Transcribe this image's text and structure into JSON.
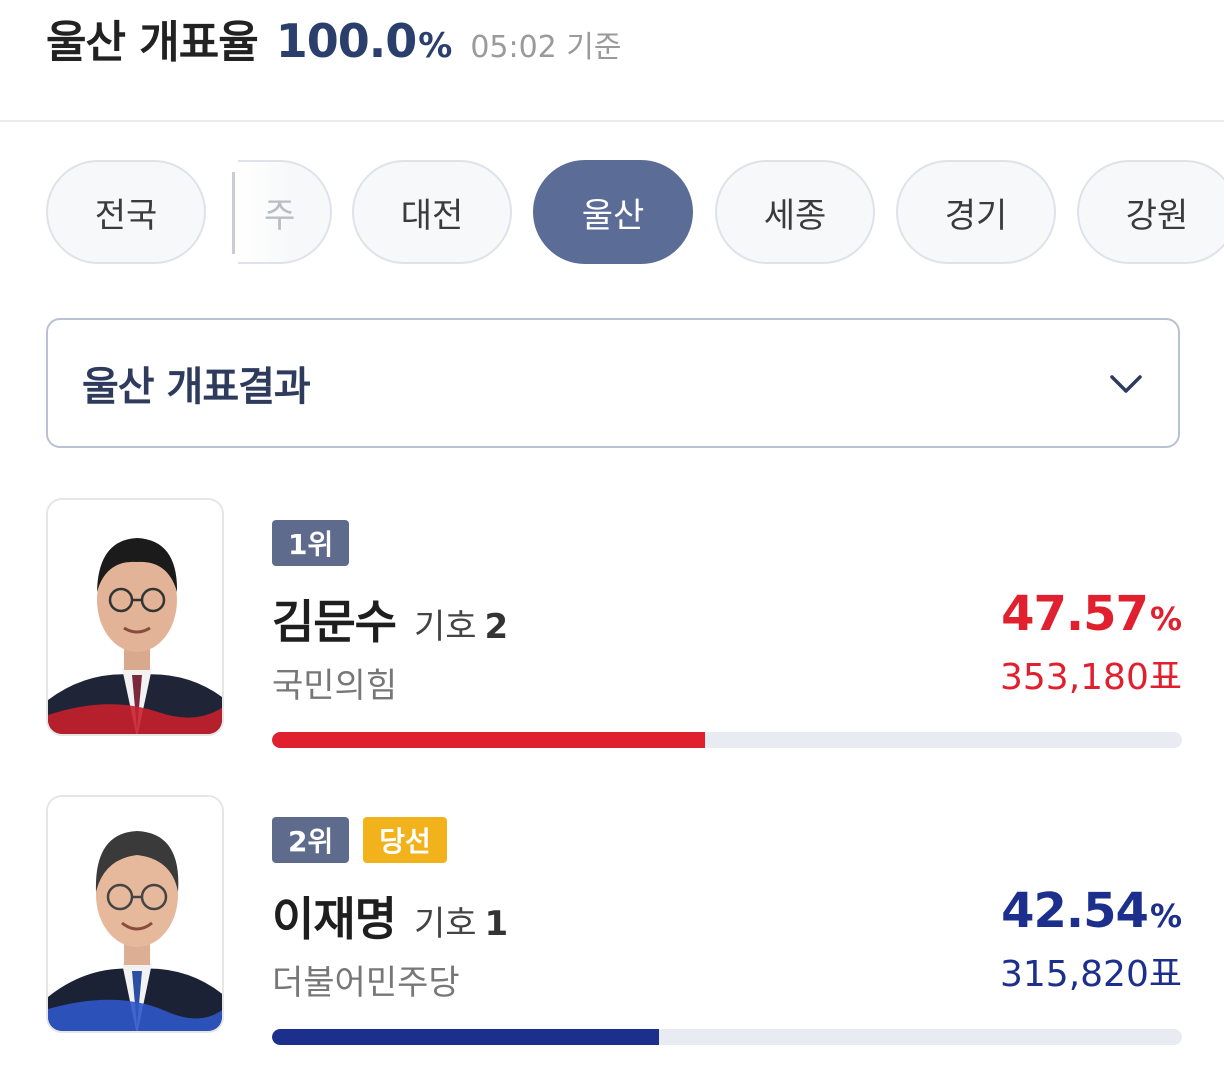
{
  "header": {
    "title": "울산 개표율",
    "rate_value": "100.0",
    "rate_unit": "%",
    "timestamp": "05:02 기준"
  },
  "tabs": [
    {
      "label": "전국",
      "active": false
    },
    {
      "label": "주",
      "active": false,
      "partial": true
    },
    {
      "label": "대전",
      "active": false
    },
    {
      "label": "울산",
      "active": true
    },
    {
      "label": "세종",
      "active": false
    },
    {
      "label": "경기",
      "active": false
    },
    {
      "label": "강원",
      "active": false
    }
  ],
  "dropdown": {
    "label": "울산 개표결과",
    "icon": "chevron-down-icon"
  },
  "candidates": [
    {
      "rank": "1위",
      "name": "김문수",
      "number_label": "기호",
      "number": "2",
      "party": "국민의힘",
      "percent": "47.57",
      "percent_unit": "%",
      "votes": "353,180표",
      "share": 47.57,
      "color": "#e0202e"
    },
    {
      "rank": "2위",
      "winner_badge": "당선",
      "name": "이재명",
      "number_label": "기호",
      "number": "1",
      "party": "더불어민주당",
      "percent": "42.54",
      "percent_unit": "%",
      "votes": "315,820표",
      "share": 42.54,
      "color": "#1c2f8c"
    }
  ],
  "colors": {
    "accent": "#5b6c97",
    "header_rate": "#2b3f6c",
    "winner_badge": "#f1b21c",
    "rank_badge": "#5e6b8c",
    "bar_track": "#e8ebf1"
  }
}
